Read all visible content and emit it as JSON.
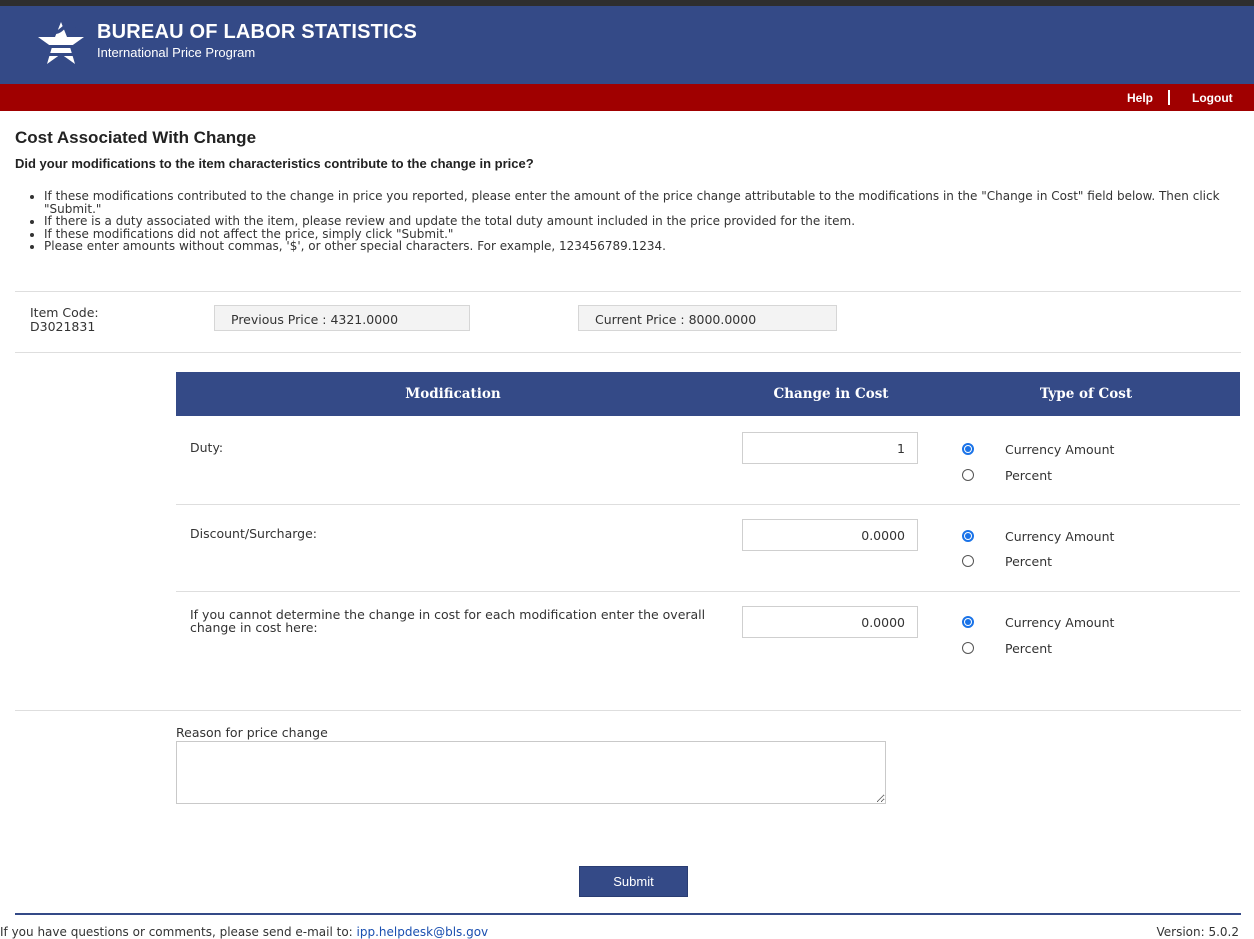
{
  "header": {
    "org_name": "BUREAU OF LABOR STATISTICS",
    "program": "International Price Program",
    "help_label": "Help",
    "logout_label": "Logout"
  },
  "page": {
    "title": "Cost Associated With Change",
    "question": "Did your modifications to the item characteristics contribute to the change in price?",
    "instructions": [
      "If these modifications contributed to the change in price you reported, please enter the amount of the price change attributable to the modifications in the \"Change in Cost\" field below. Then click \"Submit.\"",
      "If there is a duty associated with the item, please review and update the total duty amount included in the price provided for the item.",
      "If these modifications did not affect the price, simply click \"Submit.\"",
      "Please enter amounts without commas, '$', or other special characters. For example, 123456789.1234."
    ]
  },
  "item": {
    "code_label": "Item Code:",
    "code_value": "D3021831",
    "previous_price": "Previous Price : 4321.0000",
    "current_price": "Current Price : 8000.0000"
  },
  "table": {
    "headers": [
      "Modification",
      "Change in Cost",
      "Type of Cost"
    ],
    "rows": [
      {
        "label": "Duty:",
        "value": "1",
        "options": [
          "Currency Amount",
          "Percent"
        ],
        "selected": "Currency Amount"
      },
      {
        "label": "Discount/Surcharge:",
        "value": "0.0000",
        "options": [
          "Currency Amount",
          "Percent"
        ],
        "selected": "Currency Amount"
      },
      {
        "label": "If you cannot determine the change in cost for each modification enter the overall change in cost here:",
        "value": "0.0000",
        "options": [
          "Currency Amount",
          "Percent"
        ],
        "selected": "Currency Amount"
      }
    ]
  },
  "reason": {
    "label": "Reason for price change",
    "value": ""
  },
  "submit_label": "Submit",
  "footer": {
    "text": "If you have questions or comments, please send e-mail to: ",
    "email": "ipp.helpdesk@bls.gov",
    "version": "Version: 5.0.2"
  },
  "colors": {
    "header_blue": "#344a87",
    "nav_red": "#a00000",
    "radio_blue": "#1a73e8"
  },
  "icons": [
    "bls-star-logo-icon"
  ]
}
